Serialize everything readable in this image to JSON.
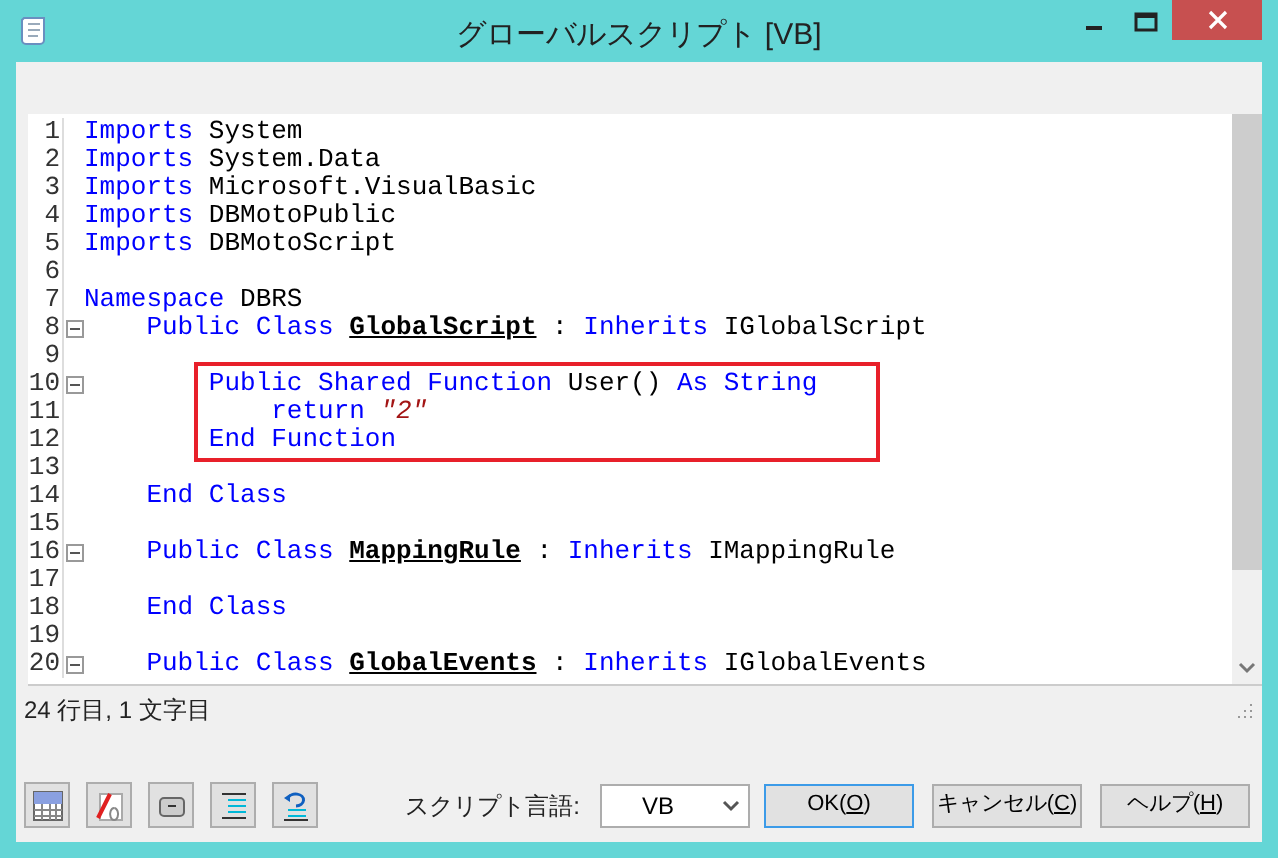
{
  "window": {
    "title": "グローバルスクリプト [VB]"
  },
  "editor": {
    "lines": [
      {
        "number": "1",
        "foldable": false,
        "highlighted": false,
        "tokens": [
          {
            "kind": "keyword",
            "text": "Imports"
          },
          {
            "kind": "plain",
            "text": " System"
          }
        ]
      },
      {
        "number": "2",
        "foldable": false,
        "highlighted": false,
        "tokens": [
          {
            "kind": "keyword",
            "text": "Imports"
          },
          {
            "kind": "plain",
            "text": " System.Data"
          }
        ]
      },
      {
        "number": "3",
        "foldable": false,
        "highlighted": false,
        "tokens": [
          {
            "kind": "keyword",
            "text": "Imports"
          },
          {
            "kind": "plain",
            "text": " Microsoft.VisualBasic"
          }
        ]
      },
      {
        "number": "4",
        "foldable": false,
        "highlighted": false,
        "tokens": [
          {
            "kind": "keyword",
            "text": "Imports"
          },
          {
            "kind": "plain",
            "text": " DBMotoPublic"
          }
        ]
      },
      {
        "number": "5",
        "foldable": false,
        "highlighted": false,
        "tokens": [
          {
            "kind": "keyword",
            "text": "Imports"
          },
          {
            "kind": "plain",
            "text": " DBMotoScript"
          }
        ]
      },
      {
        "number": "6",
        "foldable": false,
        "highlighted": false
      },
      {
        "number": "7",
        "foldable": false,
        "highlighted": false,
        "tokens": [
          {
            "kind": "keyword",
            "text": "Namespace"
          },
          {
            "kind": "plain",
            "text": " DBRS"
          }
        ]
      },
      {
        "number": "8",
        "foldable": true,
        "highlighted": false,
        "tokens": [
          {
            "kind": "keyword",
            "text": "    Public Class "
          },
          {
            "kind": "class_name",
            "text": "GlobalScript"
          },
          {
            "kind": "plain",
            "text": " : "
          },
          {
            "kind": "keyword",
            "text": "Inherits"
          },
          {
            "kind": "plain",
            "text": " IGlobalScript"
          }
        ]
      },
      {
        "number": "9",
        "foldable": false,
        "highlighted": false
      },
      {
        "number": "10",
        "foldable": true,
        "highlighted": true,
        "tokens": [
          {
            "kind": "keyword",
            "text": "        Public Shared Function"
          },
          {
            "kind": "plain",
            "text": " User() "
          },
          {
            "kind": "keyword",
            "text": "As String"
          }
        ]
      },
      {
        "number": "11",
        "foldable": false,
        "highlighted": true,
        "tokens": [
          {
            "kind": "keyword",
            "text": "            return "
          },
          {
            "kind": "string",
            "text": "\"2\""
          }
        ]
      },
      {
        "number": "12",
        "foldable": false,
        "highlighted": true,
        "tokens": [
          {
            "kind": "keyword",
            "text": "        End Function"
          }
        ]
      },
      {
        "number": "13",
        "foldable": false,
        "highlighted": false
      },
      {
        "number": "14",
        "foldable": false,
        "highlighted": false,
        "tokens": [
          {
            "kind": "keyword",
            "text": "    End Class"
          }
        ]
      },
      {
        "number": "15",
        "foldable": false,
        "highlighted": false
      },
      {
        "number": "16",
        "foldable": true,
        "highlighted": false,
        "tokens": [
          {
            "kind": "keyword",
            "text": "    Public Class "
          },
          {
            "kind": "class_name",
            "text": "MappingRule"
          },
          {
            "kind": "plain",
            "text": " : "
          },
          {
            "kind": "keyword",
            "text": "Inherits"
          },
          {
            "kind": "plain",
            "text": " IMappingRule"
          }
        ]
      },
      {
        "number": "17",
        "foldable": false,
        "highlighted": false
      },
      {
        "number": "18",
        "foldable": false,
        "highlighted": false,
        "tokens": [
          {
            "kind": "keyword",
            "text": "    End Class"
          }
        ]
      },
      {
        "number": "19",
        "foldable": false,
        "highlighted": false
      },
      {
        "number": "20",
        "foldable": true,
        "highlighted": false,
        "tokens": [
          {
            "kind": "keyword",
            "text": "    Public Class "
          },
          {
            "kind": "class_name",
            "text": "GlobalEvents"
          },
          {
            "kind": "plain",
            "text": " : "
          },
          {
            "kind": "keyword",
            "text": "Inherits"
          },
          {
            "kind": "plain",
            "text": " IGlobalEvents"
          }
        ]
      }
    ]
  },
  "status_bar": {
    "position": "24 行目, 1 文字目"
  },
  "toolbar": [
    {
      "kind": "grid"
    },
    {
      "kind": "font"
    },
    {
      "kind": "box"
    },
    {
      "kind": "indent"
    },
    {
      "kind": "undo"
    }
  ],
  "language": {
    "label": "スクリプト言語:",
    "value": "VB"
  },
  "buttons": [
    {
      "label": "OK(O)",
      "default": true
    },
    {
      "label": "キャンセル(C)",
      "default": false
    },
    {
      "label": "ヘルプ(H)",
      "default": false
    }
  ]
}
